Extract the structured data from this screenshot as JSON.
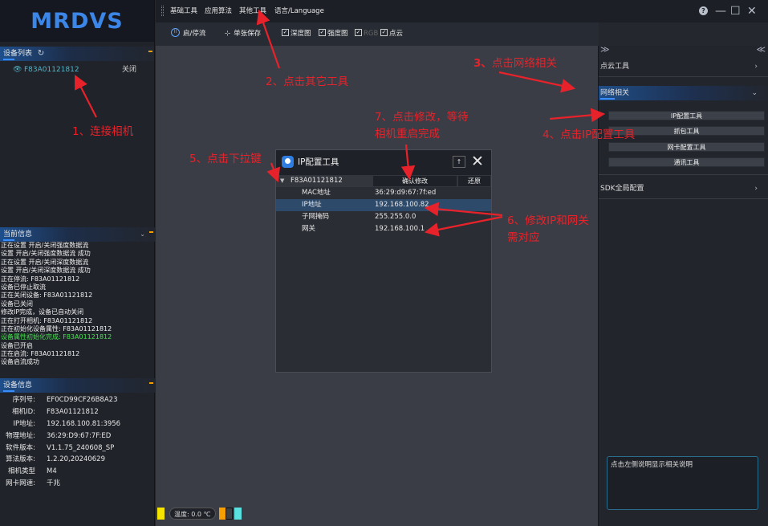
{
  "app": {
    "logo": "MRDVS"
  },
  "menu": {
    "items": [
      "基础工具",
      "应用算法",
      "其他工具",
      "语言/Language"
    ],
    "help_label": "?",
    "min_label": "—",
    "max_label": "☐",
    "close_label": "✕"
  },
  "toolbar": {
    "start_stop": "启/停流",
    "single_save": "单张保存",
    "depth": "深度图",
    "intensity": "强度图",
    "rgb": "RGB",
    "pointcloud": "点云"
  },
  "device_list": {
    "title": "设备列表",
    "devices": [
      {
        "serial": "F83A01121812",
        "status": "关闭"
      }
    ]
  },
  "log": {
    "title": "当前信息",
    "lines": [
      {
        "text": "正在设置 开启/关闭强度数据流",
        "highlight": false
      },
      {
        "text": "设置 开启/关闭强度数据流 成功",
        "highlight": false
      },
      {
        "text": "正在设置 开启/关闭深度数据流",
        "highlight": false
      },
      {
        "text": "设置 开启/关闭深度数据流 成功",
        "highlight": false
      },
      {
        "text": "正在停流: F83A01121812",
        "highlight": false
      },
      {
        "text": "设备已停止取流",
        "highlight": false
      },
      {
        "text": "正在关闭设备: F83A01121812",
        "highlight": false
      },
      {
        "text": "设备已关闭",
        "highlight": false
      },
      {
        "text": "修改IP完成，设备已自动关闭",
        "highlight": false
      },
      {
        "text": "正在打开相机: F83A01121812",
        "highlight": false
      },
      {
        "text": "正在初始化设备属性: F83A01121812",
        "highlight": false
      },
      {
        "text": "设备属性初始化完成: F83A01121812",
        "highlight": true
      },
      {
        "text": "设备已开启",
        "highlight": false
      },
      {
        "text": "正在启流: F83A01121812",
        "highlight": false
      },
      {
        "text": "设备启流成功",
        "highlight": false
      }
    ]
  },
  "device_info": {
    "title": "设备信息",
    "rows": [
      {
        "key": "序列号:",
        "value": "EF0CD99CF26B8A23"
      },
      {
        "key": "相机ID:",
        "value": "F83A01121812"
      },
      {
        "key": "IP地址:",
        "value": "192.168.100.81:3956"
      },
      {
        "key": "物理地址:",
        "value": "36:29:D9:67:7F:ED"
      },
      {
        "key": "软件版本:",
        "value": "V1.1.75_240608_SP"
      },
      {
        "key": "算法版本:",
        "value": "1.2.20,20240629"
      },
      {
        "key": "相机类型",
        "value": "M4"
      },
      {
        "key": "网卡网速:",
        "value": "千兆"
      }
    ]
  },
  "temperature": {
    "label": "温度: 0.0 ℃"
  },
  "right_panel": {
    "pointcloud_tools": "点云工具",
    "network": "网络相关",
    "buttons": [
      "IP配置工具",
      "抓包工具",
      "网卡配置工具",
      "通讯工具"
    ],
    "sdk_config": "SDK全局配置",
    "help_text": "点击左侧说明显示相关说明"
  },
  "dialog": {
    "title": "IP配置工具",
    "pin_label": "↑",
    "serial": "F83A01121812",
    "confirm_button": "确认修改",
    "restore_button": "还原",
    "rows": [
      {
        "key": "MAC地址",
        "value": "36:29:d9:67:7f:ed"
      },
      {
        "key": "IP地址",
        "value": "192.168.100.82"
      },
      {
        "key": "子网掩码",
        "value": "255.255.0.0"
      },
      {
        "key": "网关",
        "value": "192.168.100.1"
      }
    ]
  },
  "annotations": {
    "step1": "1、连接相机",
    "step2": "2、点击其它工具",
    "step3": "3、点击网络相关",
    "step4": "4、点击IP配置工具",
    "step5": "5、点击下拉键",
    "step6a": "6、修改IP和网关",
    "step6b": "需对应",
    "step7a": "7、点击修改，等待",
    "step7b": "相机重启完成",
    "color": "#e8222a"
  }
}
